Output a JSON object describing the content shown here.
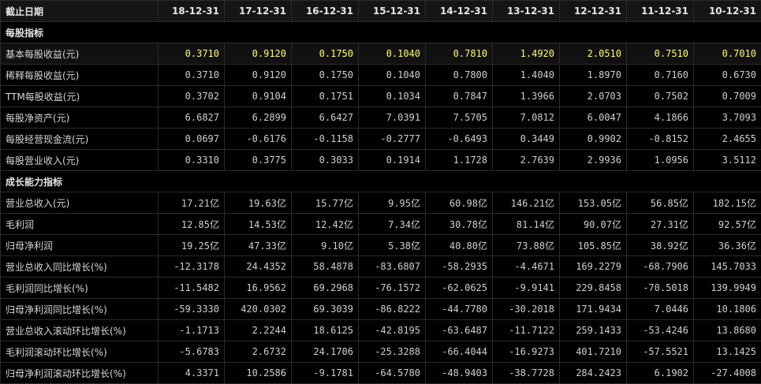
{
  "header": {
    "label": "截止日期",
    "dates": [
      "18-12-31",
      "17-12-31",
      "16-12-31",
      "15-12-31",
      "14-12-31",
      "13-12-31",
      "12-12-31",
      "11-12-31",
      "10-12-31"
    ]
  },
  "sections": [
    {
      "title": "每股指标",
      "rows": [
        {
          "label": "基本每股收益(元)",
          "highlight": true,
          "values": [
            "0.3710",
            "0.9120",
            "0.1750",
            "0.1040",
            "0.7810",
            "1.4920",
            "2.0510",
            "0.7510",
            "0.7010"
          ]
        },
        {
          "label": "稀释每股收益(元)",
          "values": [
            "0.3710",
            "0.9120",
            "0.1750",
            "0.1040",
            "0.7800",
            "1.4040",
            "1.8970",
            "0.7160",
            "0.6730"
          ]
        },
        {
          "label": "TTM每股收益(元)",
          "values": [
            "0.3702",
            "0.9104",
            "0.1751",
            "0.1034",
            "0.7847",
            "1.3966",
            "2.0703",
            "0.7502",
            "0.7009"
          ]
        },
        {
          "label": "每股净资产(元)",
          "values": [
            "6.6827",
            "6.2899",
            "6.6427",
            "7.0391",
            "7.5705",
            "7.0812",
            "6.0047",
            "4.1866",
            "3.7093"
          ]
        },
        {
          "label": "每股经营现金流(元)",
          "values": [
            "0.0697",
            "-0.6176",
            "-0.1158",
            "-0.2777",
            "-0.6493",
            "0.3449",
            "0.9902",
            "-0.8152",
            "2.4655"
          ]
        },
        {
          "label": "每股营业收入(元)",
          "values": [
            "0.3310",
            "0.3775",
            "0.3033",
            "0.1914",
            "1.1728",
            "2.7639",
            "2.9936",
            "1.0956",
            "3.5112"
          ]
        }
      ]
    },
    {
      "title": "成长能力指标",
      "rows": [
        {
          "label": "营业总收入(元)",
          "values": [
            "17.21亿",
            "19.63亿",
            "15.77亿",
            "9.95亿",
            "60.98亿",
            "146.21亿",
            "153.05亿",
            "56.85亿",
            "182.15亿"
          ]
        },
        {
          "label": "毛利润",
          "values": [
            "12.85亿",
            "14.53亿",
            "12.42亿",
            "7.34亿",
            "30.78亿",
            "81.14亿",
            "90.07亿",
            "27.31亿",
            "92.57亿"
          ]
        },
        {
          "label": "归母净利润",
          "values": [
            "19.25亿",
            "47.33亿",
            "9.10亿",
            "5.38亿",
            "40.80亿",
            "73.88亿",
            "105.85亿",
            "38.92亿",
            "36.36亿"
          ]
        },
        {
          "label": "营业总收入同比增长(%)",
          "values": [
            "-12.3178",
            "24.4352",
            "58.4878",
            "-83.6807",
            "-58.2935",
            "-4.4671",
            "169.2279",
            "-68.7906",
            "145.7033"
          ]
        },
        {
          "label": "毛利润同比增长(%)",
          "values": [
            "-11.5482",
            "16.9562",
            "69.2968",
            "-76.1572",
            "-62.0625",
            "-9.9141",
            "229.8458",
            "-70.5018",
            "139.9949"
          ]
        },
        {
          "label": "归母净利润同比增长(%)",
          "values": [
            "-59.3330",
            "420.0302",
            "69.3039",
            "-86.8222",
            "-44.7780",
            "-30.2018",
            "171.9434",
            "7.0446",
            "10.1806"
          ]
        },
        {
          "label": "营业总收入滚动环比增长(%)",
          "values": [
            "-1.1713",
            "2.2244",
            "18.6125",
            "-42.8195",
            "-63.6487",
            "-11.7122",
            "259.1433",
            "-53.4246",
            "13.8680"
          ]
        },
        {
          "label": "毛利润滚动环比增长(%)",
          "values": [
            "-5.6783",
            "2.6732",
            "24.1706",
            "-25.3288",
            "-66.4044",
            "-16.9273",
            "401.7210",
            "-57.5521",
            "13.1425"
          ]
        },
        {
          "label": "归母净利润滚动环比增长(%)",
          "values": [
            "4.3371",
            "10.2586",
            "-9.1781",
            "-64.5780",
            "-48.9403",
            "-38.7728",
            "284.2423",
            "6.1902",
            "-27.4008"
          ]
        }
      ]
    }
  ]
}
